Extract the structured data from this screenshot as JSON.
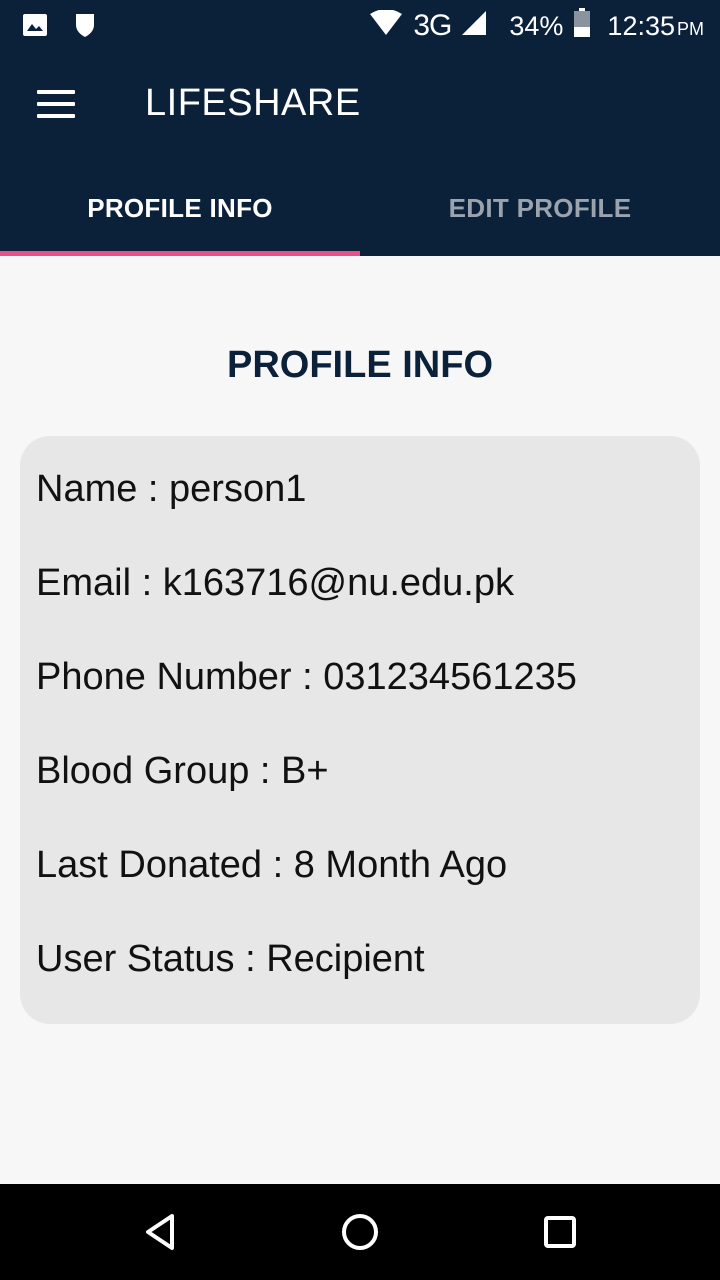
{
  "status_bar": {
    "left_icons": [
      "image-icon",
      "shield-icon"
    ],
    "network": "3G",
    "battery": "34%",
    "time": "12:35",
    "time_suffix": "PM"
  },
  "app_bar": {
    "title": "LIFESHARE",
    "menu_icon": "hamburger-menu-icon"
  },
  "tabs": [
    {
      "label": "PROFILE INFO",
      "active": true
    },
    {
      "label": "EDIT PROFILE",
      "active": false
    }
  ],
  "content": {
    "section_title": "PROFILE INFO",
    "fields": [
      "Name : person1",
      "Email : k163716@nu.edu.pk",
      "Phone Number : 031234561235",
      "Blood Group : B+",
      "Last Donated : 8 Month Ago",
      "User Status : Recipient"
    ]
  },
  "nav_bar": {
    "icons": [
      "back-icon",
      "home-icon",
      "recents-icon"
    ]
  },
  "colors": {
    "primary": "#0b213a",
    "accent": "#e8508a",
    "card": "#e7e7e7",
    "background": "#f7f7f7"
  }
}
